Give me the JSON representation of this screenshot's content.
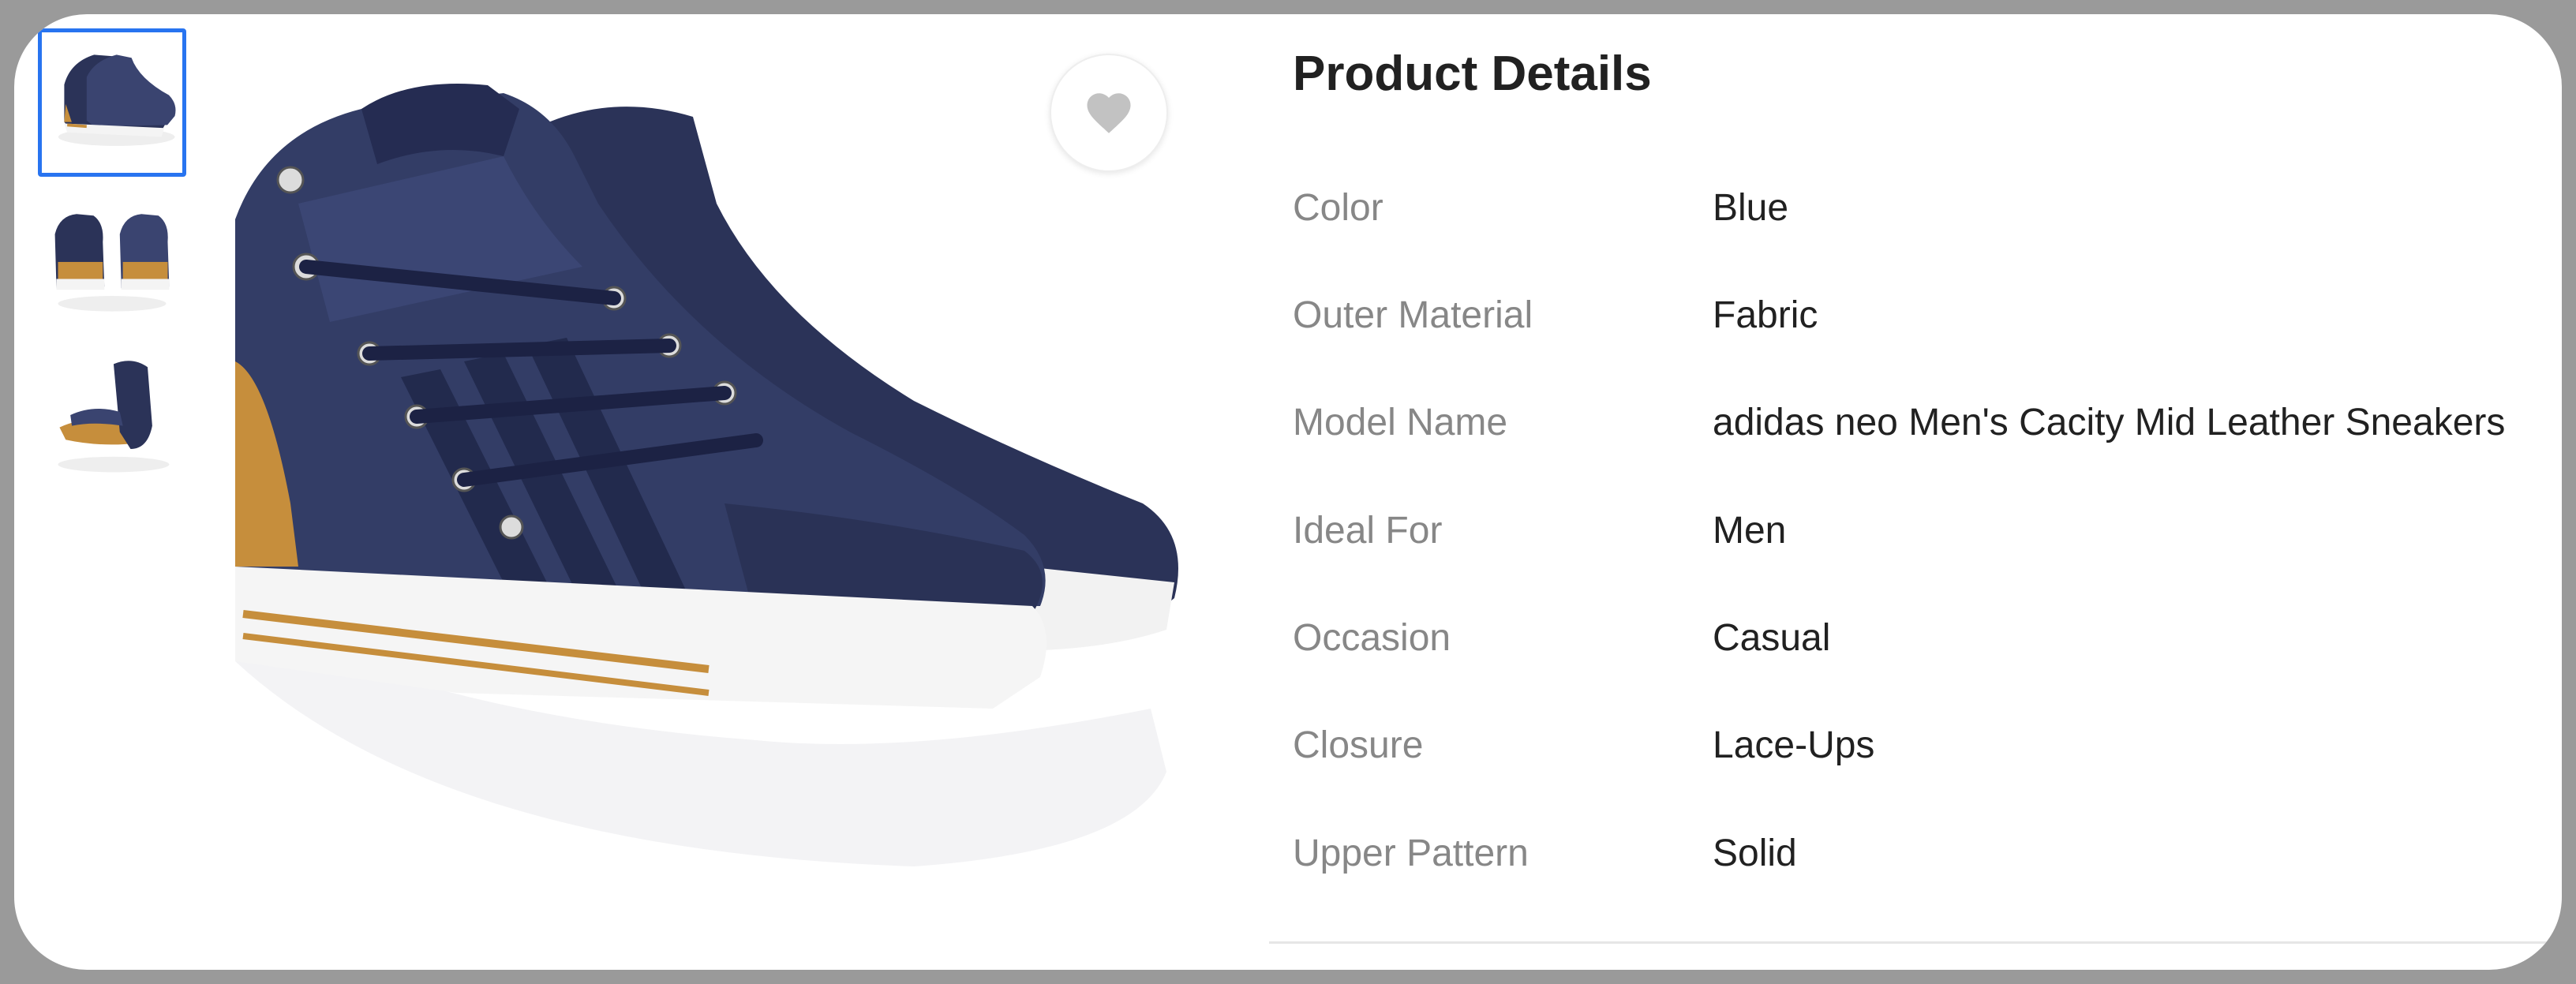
{
  "gallery": {
    "thumbnails": [
      {
        "view": "side-pair",
        "selected": true
      },
      {
        "view": "back-pair",
        "selected": false
      },
      {
        "view": "sole-pair",
        "selected": false
      }
    ],
    "main_view": "side-pair",
    "wishlist_icon": "heart-icon"
  },
  "details": {
    "title": "Product Details",
    "specs": [
      {
        "label": "Color",
        "value": "Blue"
      },
      {
        "label": "Outer Material",
        "value": "Fabric"
      },
      {
        "label": "Model Name",
        "value": "adidas neo Men's Cacity Mid Leather Sneakers"
      },
      {
        "label": "Ideal For",
        "value": "Men"
      },
      {
        "label": "Occasion",
        "value": "Casual"
      },
      {
        "label": "Closure",
        "value": "Lace-Ups"
      },
      {
        "label": "Upper Pattern",
        "value": "Solid"
      }
    ]
  },
  "colors": {
    "accent": "#2874f0",
    "label_text": "#878787",
    "value_text": "#212121",
    "shoe_navy": "#2b3358",
    "shoe_tan": "#c68e3c"
  }
}
